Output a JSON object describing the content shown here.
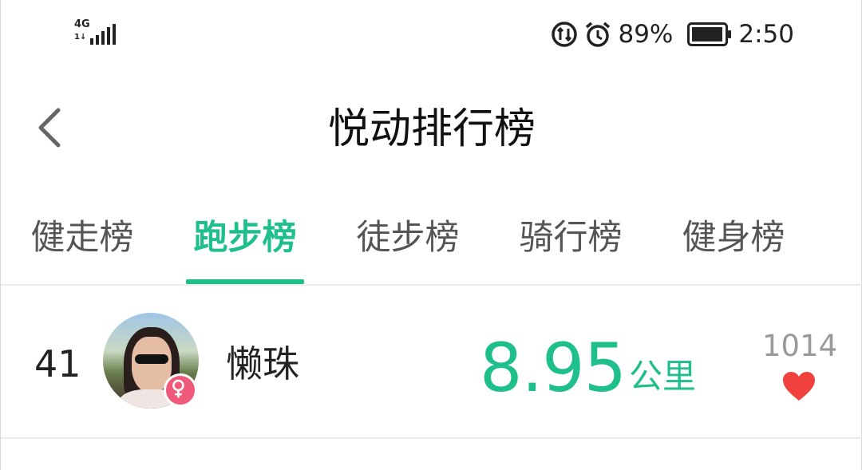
{
  "status_bar": {
    "network_top": "4G",
    "network_bottom": "1↓",
    "battery_percent": "89%",
    "time": "2:50",
    "icons": [
      "signal-icon",
      "data-saver-icon",
      "alarm-icon",
      "battery-icon"
    ]
  },
  "header": {
    "title": "悦动排行榜",
    "back_icon": "chevron-left-icon"
  },
  "tabs": [
    {
      "label": "健走榜",
      "active": false
    },
    {
      "label": "跑步榜",
      "active": true
    },
    {
      "label": "徒步榜",
      "active": false
    },
    {
      "label": "骑行榜",
      "active": false
    },
    {
      "label": "健身榜",
      "active": false
    }
  ],
  "ranking": {
    "rows": [
      {
        "rank": "41",
        "name": "懒珠",
        "gender": "female",
        "distance_value": "8.95",
        "distance_unit": "公里",
        "likes": "1014"
      }
    ]
  },
  "colors": {
    "accent": "#1fbf8b",
    "heart": "#f0413f",
    "female_badge": "#f05a7a"
  }
}
